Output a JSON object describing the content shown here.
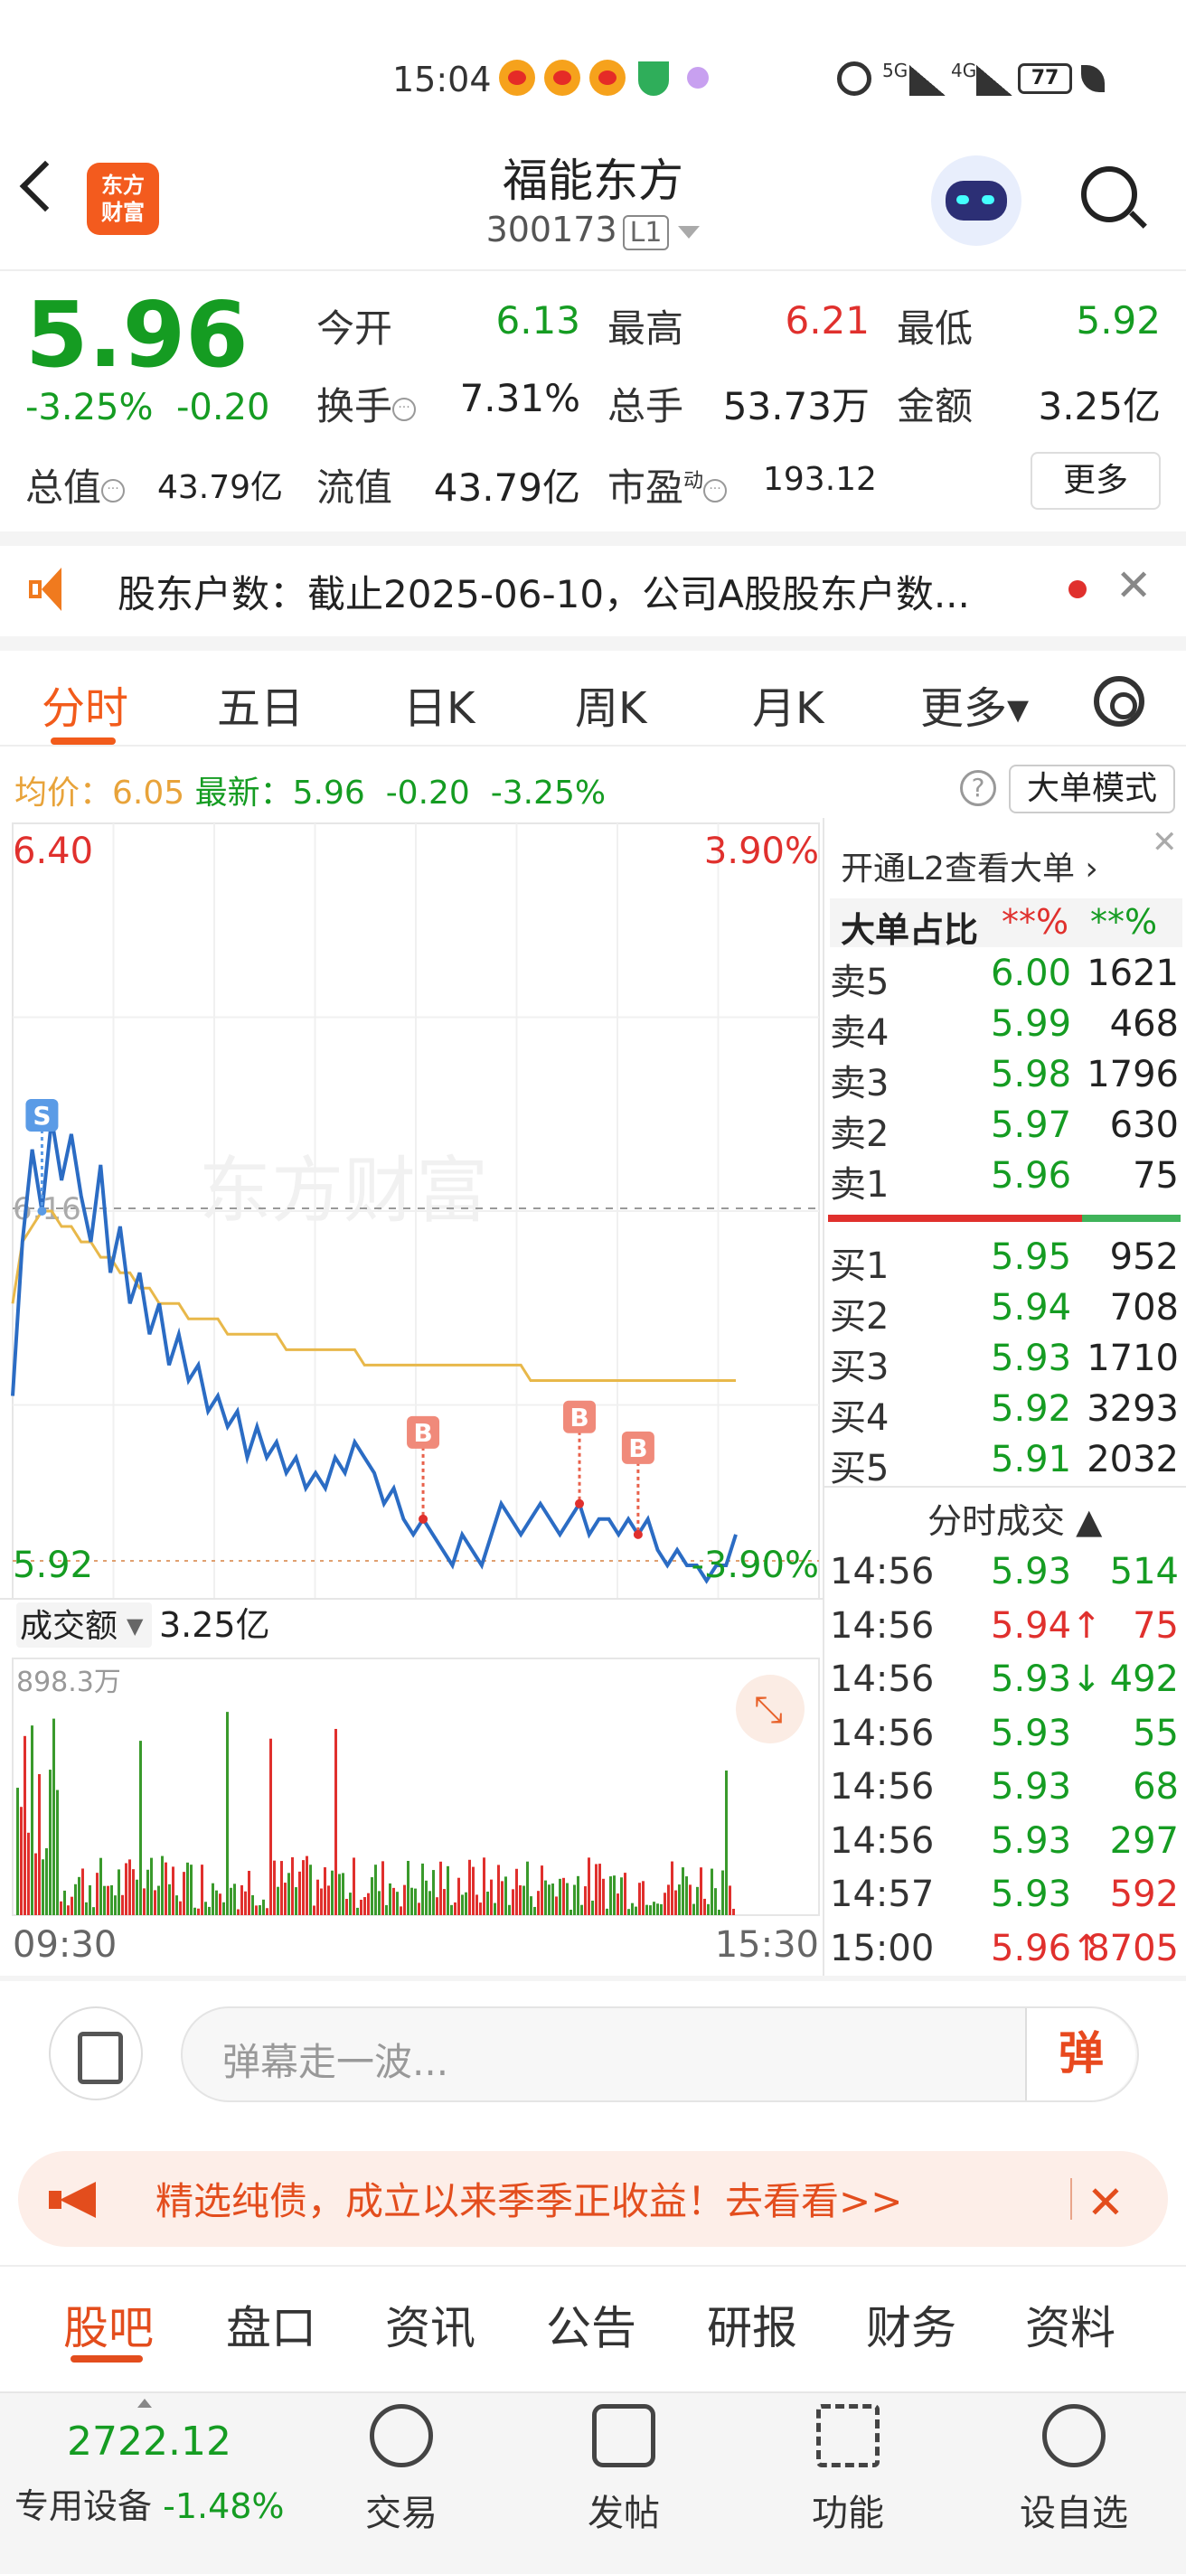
{
  "status_bar": {
    "time": "15:04",
    "network1": "5G",
    "network2": "4G",
    "battery": "77"
  },
  "header": {
    "logo_text": "东方\n财富",
    "stock_name": "福能东方",
    "stock_code": "300173",
    "level": "L1"
  },
  "quote": {
    "price": "5.96",
    "change_pct": "-3.25%",
    "change_abs": "-0.20",
    "open_label": "今开",
    "open_value": "6.13",
    "high_label": "最高",
    "high_value": "6.21",
    "low_label": "最低",
    "low_value": "5.92",
    "turnover_label": "换手",
    "turnover_value": "7.31%",
    "volume_label": "总手",
    "volume_value": "53.73万",
    "amount_label": "金额",
    "amount_value": "3.25亿",
    "mktcap_label": "总值",
    "mktcap_value": "43.79亿",
    "float_label": "流值",
    "float_value": "43.79亿",
    "pe_label": "市盈",
    "pe_sup": "动",
    "pe_value": "193.12",
    "more_label": "更多"
  },
  "notice": {
    "text": "股东户数：截止2025-06-10，公司A股股东户数..."
  },
  "chart_tabs": [
    "分时",
    "五日",
    "日K",
    "周K",
    "月K",
    "更多▾"
  ],
  "info_line": {
    "avg_label": "均价：",
    "avg_value": "6.05",
    "latest_label": "最新：",
    "latest_value": "5.96",
    "chg": "-0.20",
    "pct": "-3.25%",
    "mode_btn": "大单模式"
  },
  "chart_data": {
    "type": "line",
    "y_top_label": "6.40",
    "y_top_pct": "3.90%",
    "y_bottom_label": "5.92",
    "y_bottom_pct": "-3.90%",
    "ylim": [
      5.92,
      6.4
    ],
    "prev_close": "6.16",
    "watermark": "东方财富",
    "x_start": "09:30",
    "x_end": "15:30",
    "markers": [
      "S",
      "B",
      "B",
      "B"
    ],
    "series": [
      {
        "name": "价格",
        "color": "#2b6cc4",
        "values": [
          6.04,
          6.14,
          6.2,
          6.16,
          6.22,
          6.18,
          6.21,
          6.17,
          6.14,
          6.19,
          6.12,
          6.15,
          6.1,
          6.12,
          6.08,
          6.1,
          6.06,
          6.08,
          6.05,
          6.06,
          6.03,
          6.04,
          6.02,
          6.03,
          6.0,
          6.02,
          6.0,
          6.01,
          5.99,
          6.0,
          5.98,
          5.99,
          5.98,
          6.0,
          5.99,
          6.01,
          6.0,
          5.99,
          5.97,
          5.98,
          5.96,
          5.95,
          5.96,
          5.95,
          5.94,
          5.93,
          5.95,
          5.94,
          5.93,
          5.95,
          5.97,
          5.96,
          5.95,
          5.96,
          5.97,
          5.96,
          5.95,
          5.96,
          5.97,
          5.95,
          5.96,
          5.96,
          5.95,
          5.96,
          5.95,
          5.96,
          5.94,
          5.93,
          5.94,
          5.93,
          5.93,
          5.92,
          5.93,
          5.93,
          5.95
        ]
      },
      {
        "name": "均价",
        "color": "#e8b84a",
        "values": [
          6.1,
          6.14,
          6.15,
          6.16,
          6.16,
          6.15,
          6.15,
          6.14,
          6.14,
          6.13,
          6.13,
          6.12,
          6.12,
          6.11,
          6.11,
          6.1,
          6.1,
          6.1,
          6.09,
          6.09,
          6.09,
          6.09,
          6.08,
          6.08,
          6.08,
          6.08,
          6.08,
          6.08,
          6.07,
          6.07,
          6.07,
          6.07,
          6.07,
          6.07,
          6.07,
          6.07,
          6.06,
          6.06,
          6.06,
          6.06,
          6.06,
          6.06,
          6.06,
          6.06,
          6.06,
          6.06,
          6.06,
          6.06,
          6.06,
          6.06,
          6.06,
          6.06,
          6.06,
          6.05,
          6.05,
          6.05,
          6.05,
          6.05,
          6.05,
          6.05,
          6.05,
          6.05,
          6.05,
          6.05,
          6.05,
          6.05,
          6.05,
          6.05,
          6.05,
          6.05,
          6.05,
          6.05,
          6.05,
          6.05,
          6.05
        ]
      }
    ],
    "volume_label": "成交额",
    "volume_total": "3.25亿",
    "volume_max_label": "898.3万"
  },
  "orderbook": {
    "l2_link": "开通L2查看大单 ›",
    "big_ratio_label": "大单占比",
    "big_ratio_v1": "**%",
    "big_ratio_v2": "**%",
    "asks": [
      {
        "label": "卖5",
        "price": "6.00",
        "vol": "1621"
      },
      {
        "label": "卖4",
        "price": "5.99",
        "vol": "468"
      },
      {
        "label": "卖3",
        "price": "5.98",
        "vol": "1796"
      },
      {
        "label": "卖2",
        "price": "5.97",
        "vol": "630"
      },
      {
        "label": "卖1",
        "price": "5.96",
        "vol": "75"
      }
    ],
    "bids": [
      {
        "label": "买1",
        "price": "5.95",
        "vol": "952"
      },
      {
        "label": "买2",
        "price": "5.94",
        "vol": "708"
      },
      {
        "label": "买3",
        "price": "5.93",
        "vol": "1710"
      },
      {
        "label": "买4",
        "price": "5.92",
        "vol": "3293"
      },
      {
        "label": "买5",
        "price": "5.91",
        "vol": "2032"
      }
    ],
    "trades_title": "分时成交 ▲",
    "trades": [
      {
        "time": "14:56",
        "price": "5.93",
        "vol": "514",
        "dir": ""
      },
      {
        "time": "14:56",
        "price": "5.94↑",
        "vol": "75",
        "dir": "up"
      },
      {
        "time": "14:56",
        "price": "5.93↓",
        "vol": "492",
        "dir": "down"
      },
      {
        "time": "14:56",
        "price": "5.93",
        "vol": "55",
        "dir": ""
      },
      {
        "time": "14:56",
        "price": "5.93",
        "vol": "68",
        "dir": ""
      },
      {
        "time": "14:56",
        "price": "5.93",
        "vol": "297",
        "dir": ""
      },
      {
        "time": "14:57",
        "price": "5.93",
        "vol": "592",
        "dir": "red"
      },
      {
        "time": "15:00",
        "price": "5.96↑",
        "vol": "8705",
        "dir": "up"
      }
    ]
  },
  "danmu": {
    "placeholder": "弹幕走一波...",
    "btn": "弹"
  },
  "banner": {
    "text": "精选纯债，成立以来季季正收益！去看看>>"
  },
  "bottom_tabs": [
    "股吧",
    "盘口",
    "资讯",
    "公告",
    "研报",
    "财务",
    "资料"
  ],
  "bottom_bar": {
    "index_value": "2722.12",
    "index_name": "专用设备",
    "index_chg": "-1.48%",
    "items": [
      "交易",
      "发帖",
      "功能",
      "设自选"
    ]
  },
  "colors": {
    "up": "#e0302d",
    "down": "#159c22",
    "accent": "#f25b1b"
  }
}
